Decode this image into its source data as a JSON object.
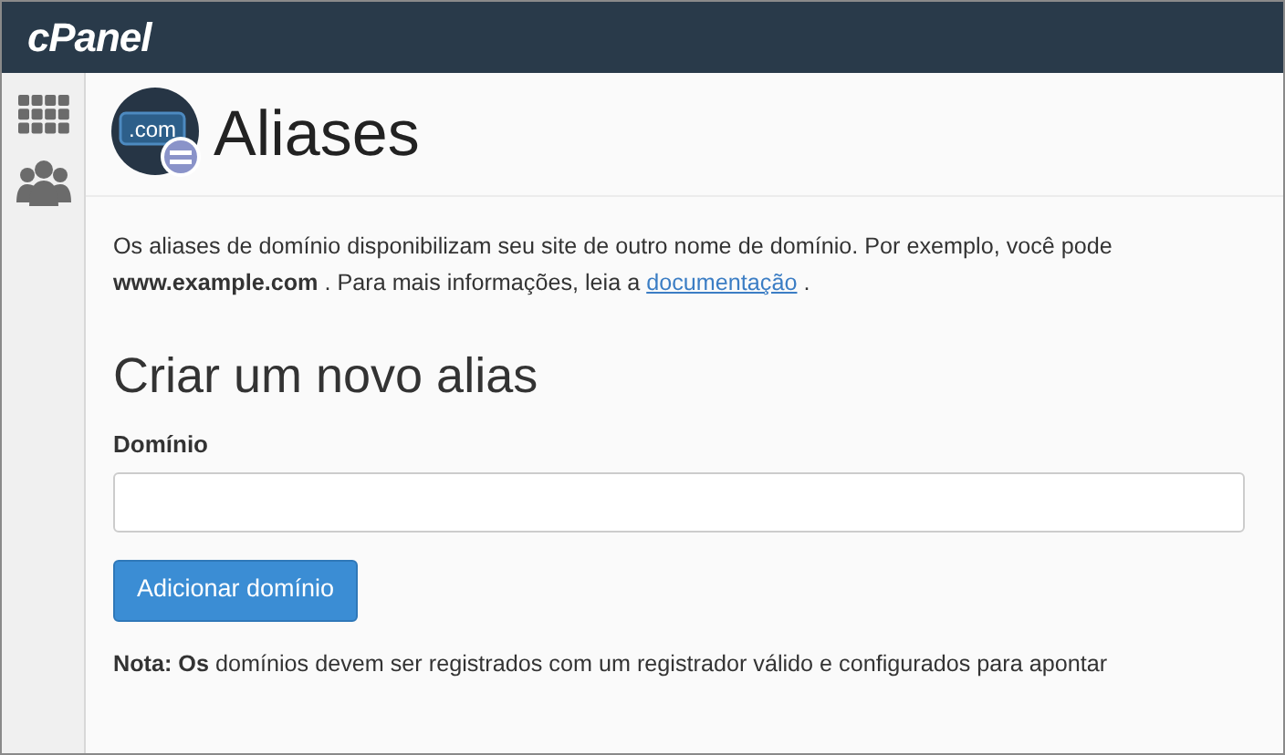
{
  "topbar": {
    "logo": "cPanel"
  },
  "sidebar": {
    "items": [
      {
        "kind": "grid"
      },
      {
        "kind": "users"
      }
    ]
  },
  "page": {
    "title": "Aliases",
    "icon_text": ".com"
  },
  "intro": {
    "line_1": "Os aliases de domínio disponibilizam seu site de outro nome de domínio. Por exemplo, você pode",
    "line_2": "**www.example.com** . Para mais informações, leia a",
    "link": "documentação",
    "line_2_end": "."
  },
  "form": {
    "heading": "Criar um novo alias",
    "field_label": "Domínio",
    "button": "Adicionar domínio"
  },
  "note": "**Nota: Os** domínios devem ser registrados com um registrador válido e configurados para apontar"
}
